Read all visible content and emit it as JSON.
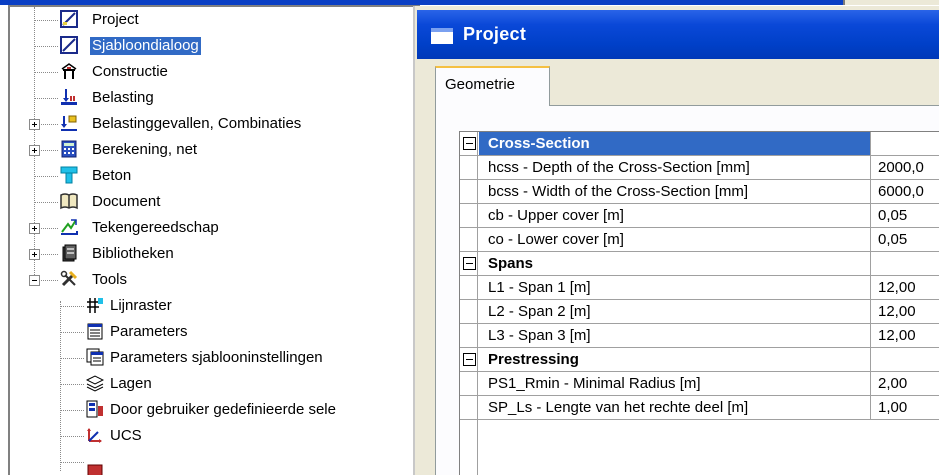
{
  "tree": {
    "items": [
      {
        "label": "Project"
      },
      {
        "label": "Sjabloondialoog"
      },
      {
        "label": "Constructie"
      },
      {
        "label": "Belasting"
      },
      {
        "label": "Belastinggevallen, Combinaties"
      },
      {
        "label": "Berekening, net"
      },
      {
        "label": "Beton"
      },
      {
        "label": "Document"
      },
      {
        "label": "Tekengereedschap"
      },
      {
        "label": "Bibliotheken"
      },
      {
        "label": "Tools"
      },
      {
        "label": "Lijnraster"
      },
      {
        "label": "Parameters"
      },
      {
        "label": "Parameters sjablooninstellingen"
      },
      {
        "label": "Lagen"
      },
      {
        "label": "Door gebruiker gedefinieerde sele"
      },
      {
        "label": "UCS"
      }
    ]
  },
  "dialog": {
    "title": "Project",
    "tabs": [
      {
        "label": "Geometrie"
      }
    ],
    "grid": {
      "categories": [
        {
          "name": "Cross-Section",
          "properties": [
            {
              "name": "hcss - Depth of the Cross-Section [mm]",
              "value": "2000,0"
            },
            {
              "name": "bcss - Width of the Cross-Section [mm]",
              "value": "6000,0"
            },
            {
              "name": "cb - Upper cover [m]",
              "value": "0,05"
            },
            {
              "name": "co - Lower cover [m]",
              "value": "0,05"
            }
          ]
        },
        {
          "name": "Spans",
          "properties": [
            {
              "name": "L1 - Span 1 [m]",
              "value": "12,00"
            },
            {
              "name": "L2 - Span 2 [m]",
              "value": "12,00"
            },
            {
              "name": "L3 - Span 3 [m]",
              "value": "12,00"
            }
          ]
        },
        {
          "name": "Prestressing",
          "properties": [
            {
              "name": "PS1_Rmin - Minimal Radius [m]",
              "value": "2,00"
            },
            {
              "name": "SP_Ls - Lengte van het rechte deel [m]",
              "value": "1,00"
            }
          ]
        }
      ]
    }
  }
}
